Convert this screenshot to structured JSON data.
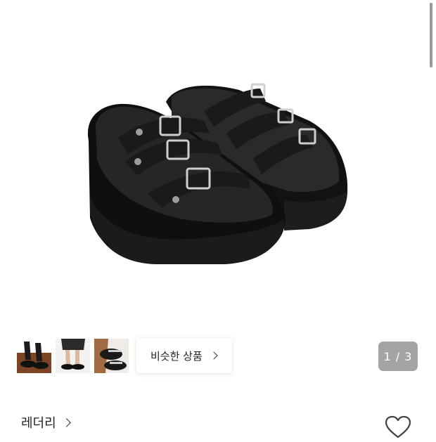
{
  "gallery": {
    "image_alt": "black-platform-buckle-sandals",
    "counter": "1 / 3"
  },
  "similar": {
    "label": "비슷한 상품"
  },
  "brand": {
    "label": "레더리"
  },
  "colors": {
    "counter_bg": "#a4a4a4",
    "product": "#141414"
  },
  "icons": {
    "like": "heart-outline-icon",
    "more": "chevron-right-icon"
  }
}
